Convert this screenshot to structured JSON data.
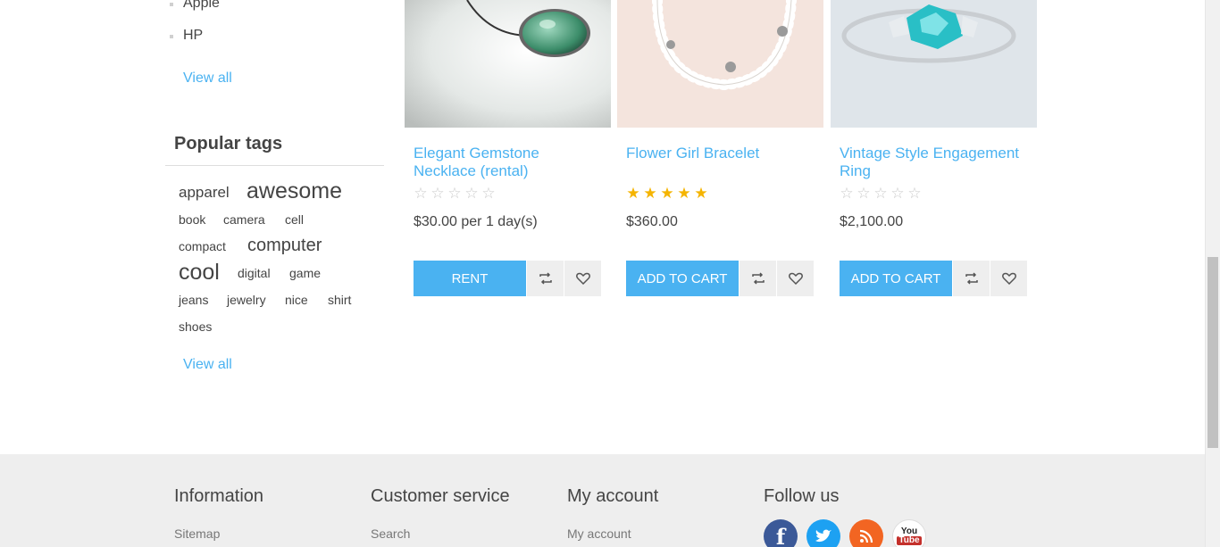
{
  "sidebar": {
    "manufacturers": [
      "Apple",
      "HP"
    ],
    "manufacturers_view_all": "View all",
    "tags_title": "Popular tags",
    "tags": [
      "apparel",
      "awesome",
      "book",
      "camera",
      "cell",
      "compact",
      "computer",
      "cool",
      "digital",
      "game",
      "jeans",
      "jewelry",
      "nice",
      "shirt",
      "shoes"
    ],
    "tags_view_all": "View all"
  },
  "products": [
    {
      "title": "Elegant Gemstone Necklace (rental)",
      "rating": 0,
      "price": "$30.00 per 1 day(s)",
      "button": "RENT"
    },
    {
      "title": "Flower Girl Bracelet",
      "rating": 5,
      "price": "$360.00",
      "button": "ADD TO CART"
    },
    {
      "title": "Vintage Style Engagement Ring",
      "rating": 0,
      "price": "$2,100.00",
      "button": "ADD TO CART"
    }
  ],
  "footer": {
    "columns": [
      {
        "title": "Information",
        "link": "Sitemap"
      },
      {
        "title": "Customer service",
        "link": "Search"
      },
      {
        "title": "My account",
        "link": "My account"
      },
      {
        "title": "Follow us",
        "link": ""
      }
    ],
    "social": [
      {
        "name": "facebook-icon",
        "label": "f",
        "color": "#3b5998"
      },
      {
        "name": "twitter-icon",
        "label": "t",
        "color": "#1da1f2"
      },
      {
        "name": "rss-icon",
        "label": "rss",
        "color": "#f26522"
      },
      {
        "name": "youtube-icon",
        "label": "You Tube",
        "color": "#ffffff"
      }
    ]
  },
  "colors": {
    "accent": "#4ab2f1",
    "star_filled": "#f5b400",
    "star_empty": "#cccccc"
  }
}
